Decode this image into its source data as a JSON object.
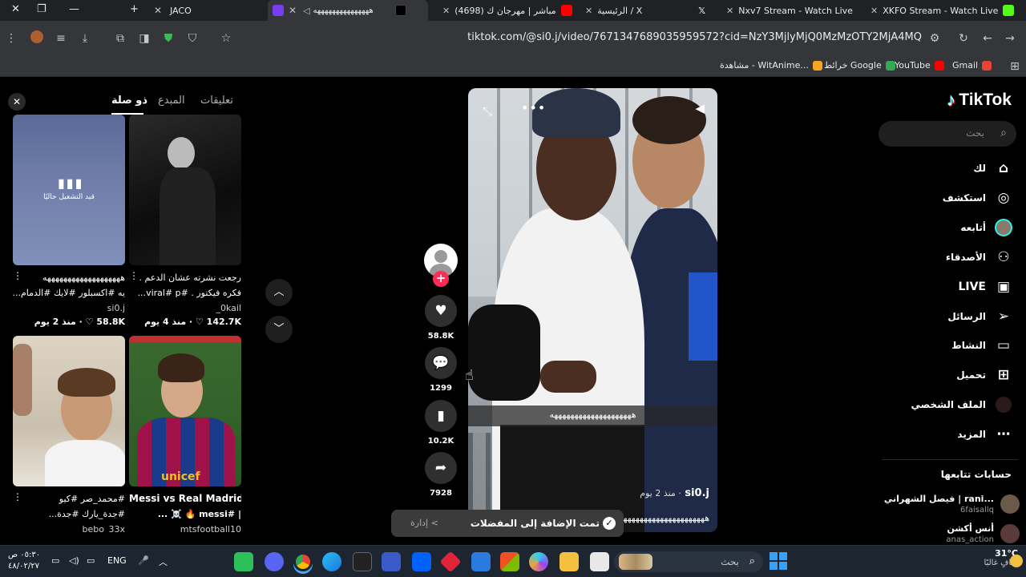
{
  "browser": {
    "tabs": [
      {
        "title": "JACO",
        "color": "#111111"
      },
      {
        "title": "هههههههههههههههه",
        "color": "#000000"
      },
      {
        "title": "(4698) مباشر | مهرجان ك",
        "color": "#ff0000"
      },
      {
        "title": "الرئيسية / X",
        "color": "#000000"
      },
      {
        "title": "Nxv7 Stream - Watch Live",
        "color": "#53fc18"
      },
      {
        "title": "XKFO Stream - Watch Live",
        "color": "#53fc18"
      }
    ],
    "url": "tiktok.com/@si0.j/video/7671347689035959572?cid=NzY3MjlyMjQ0MzMzOTY2MjA4MQ",
    "bookmarks": [
      {
        "label": "Gmail",
        "color": "#ea4335"
      },
      {
        "label": "YouTube",
        "color": "#ff0000"
      },
      {
        "label": "خرائط Google",
        "color": "#34a853"
      },
      {
        "label": "مشاهدة - WitAnime...",
        "color": "#f5a623"
      }
    ]
  },
  "sidebar": {
    "logo": "TikTok",
    "search_placeholder": "بحث",
    "nav": [
      {
        "label": "لك",
        "icon": "home-icon",
        "glyph": "⌂"
      },
      {
        "label": "استكشف",
        "icon": "compass-icon",
        "glyph": "◎"
      },
      {
        "label": "أتابعه",
        "icon": "following-avatar-icon",
        "glyph": "●"
      },
      {
        "label": "الأصدقاء",
        "icon": "friends-icon",
        "glyph": "👥"
      },
      {
        "label": "LIVE",
        "icon": "live-icon",
        "glyph": "▣"
      },
      {
        "label": "الرسائل",
        "icon": "messages-icon",
        "glyph": "➤"
      },
      {
        "label": "النشاط",
        "icon": "activity-icon",
        "glyph": "▢"
      },
      {
        "label": "تحميل",
        "icon": "upload-icon",
        "glyph": "⊞"
      },
      {
        "label": "الملف الشخصي",
        "icon": "profile-icon",
        "glyph": "●"
      },
      {
        "label": "المزيد",
        "icon": "more-icon",
        "glyph": "⋯"
      }
    ],
    "following_heading": "حسابات تتابعها",
    "accounts": [
      {
        "name": "فيصل الشهراني | rani...",
        "handle": "6faisallq"
      },
      {
        "name": "أنس أكشن",
        "handle": "anas_action"
      }
    ]
  },
  "video": {
    "caption_overlay": "ههههههههههههههههههههه",
    "author": "si0.j",
    "time": "· منذ 2 يوم",
    "description": "هههههههههههههههههههههه"
  },
  "actions": {
    "likes": "58.8K",
    "comments": "1299",
    "saves": "10.2K",
    "shares": "7928"
  },
  "panel": {
    "tabs": [
      "تعليقات",
      "المبدع",
      "ذو صلة"
    ],
    "active_tab": "ذو صلة",
    "now_playing": "قيد التشغيل حاليًا",
    "cards": [
      {
        "title1": "رجعت نشرته عشان الدعم .",
        "title2": "فكره فيكتور . #viral#  p...",
        "author": "_0kail",
        "meta": "142.7K ♡ · منذ 4 يوم"
      },
      {
        "title1": "هههههههههههههههههههه",
        "title2": "يه #اكسبلور #لايك #الدمام...",
        "author": "si0.j",
        "meta": "58.8K ♡ · منذ 2 يوم"
      },
      {
        "title1": "Messi vs Real Madrid",
        "title2": "| #messi 🔥 ☠️ ...",
        "author": "mtsfootball10",
        "meta": ""
      },
      {
        "title1": "#محمد_صر #كيو",
        "title2": "#جدة_يارك #جدة...",
        "author": "bebo_33x",
        "meta": ""
      }
    ]
  },
  "toast": {
    "message": "تمت الإضافة إلى المفضلات",
    "manage": "إدارة <"
  },
  "taskbar": {
    "search_placeholder": "بحث",
    "language": "ENG",
    "time": "٠٥:٣٠ ص",
    "date": "٤٨/٠٢/٢٧",
    "weather_temp": "31°C",
    "weather_desc": "صافٍ غالبًا"
  }
}
